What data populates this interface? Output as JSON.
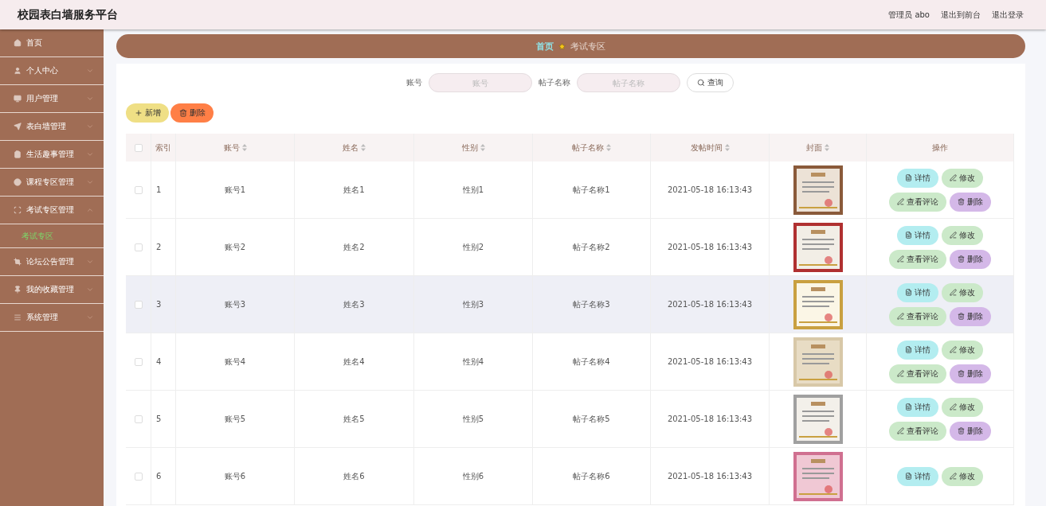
{
  "header": {
    "title": "校园表白墙服务平台",
    "links": [
      "管理员 abo",
      "退出到前台",
      "退出登录"
    ]
  },
  "sidebar": {
    "items": [
      {
        "label": "首页",
        "expandable": false
      },
      {
        "label": "个人中心",
        "expandable": true,
        "expanded": false
      },
      {
        "label": "用户管理",
        "expandable": true,
        "expanded": false
      },
      {
        "label": "表白墙管理",
        "expandable": true,
        "expanded": false
      },
      {
        "label": "生活趣事管理",
        "expandable": true,
        "expanded": false
      },
      {
        "label": "课程专区管理",
        "expandable": true,
        "expanded": false
      },
      {
        "label": "考试专区管理",
        "expandable": true,
        "expanded": true,
        "children": [
          {
            "label": "考试专区",
            "selected": true
          }
        ]
      },
      {
        "label": "论坛公告管理",
        "expandable": true,
        "expanded": false
      },
      {
        "label": "我的收藏管理",
        "expandable": true,
        "expanded": false
      },
      {
        "label": "系统管理",
        "expandable": true,
        "expanded": false
      }
    ]
  },
  "breadcrumb": [
    "首页",
    "考试专区"
  ],
  "search": {
    "fields": [
      {
        "label": "账号",
        "placeholder": "账号"
      },
      {
        "label": "帖子名称",
        "placeholder": "帖子名称"
      }
    ],
    "button": "查询"
  },
  "actions": [
    {
      "label": "新增",
      "kind": "add"
    },
    {
      "label": "删除",
      "kind": "delete"
    }
  ],
  "table": {
    "all_checked": false,
    "columns": [
      {
        "label": "索引",
        "sortable": false
      },
      {
        "label": "账号",
        "sortable": true
      },
      {
        "label": "姓名",
        "sortable": true
      },
      {
        "label": "性别",
        "sortable": true
      },
      {
        "label": "帖子名称",
        "sortable": true
      },
      {
        "label": "发帖时间",
        "sortable": true
      },
      {
        "label": "封面",
        "sortable": true
      },
      {
        "label": "操作",
        "sortable": false
      }
    ],
    "rows": [
      {
        "index": "1",
        "account": "账号1",
        "name": "姓名1",
        "gender": "性别1",
        "post": "帖子名称1",
        "time": "2021-05-18 16:13:43",
        "cover": {
          "kind": "picture"
        },
        "checked": false,
        "highlighted": false,
        "buttons": [
          {
            "label": "详情",
            "kind": "detail"
          },
          {
            "label": "修改",
            "kind": "edit"
          },
          {
            "label": "查看评论",
            "kind": "comment"
          },
          {
            "label": "删除",
            "kind": "delete"
          }
        ]
      },
      {
        "index": "2",
        "account": "账号2",
        "name": "姓名2",
        "gender": "性别2",
        "post": "帖子名称2",
        "time": "2021-05-18 16:13:43",
        "cover": {
          "kind": "picture"
        },
        "checked": false,
        "highlighted": false,
        "buttons": [
          {
            "label": "详情",
            "kind": "detail"
          },
          {
            "label": "修改",
            "kind": "edit"
          },
          {
            "label": "查看评论",
            "kind": "comment"
          },
          {
            "label": "删除",
            "kind": "delete"
          }
        ]
      },
      {
        "index": "3",
        "account": "账号3",
        "name": "姓名3",
        "gender": "性别3",
        "post": "帖子名称3",
        "time": "2021-05-18 16:13:43",
        "cover": {
          "kind": "picture"
        },
        "checked": false,
        "highlighted": true,
        "buttons": [
          {
            "label": "详情",
            "kind": "detail"
          },
          {
            "label": "修改",
            "kind": "edit"
          },
          {
            "label": "查看评论",
            "kind": "comment"
          },
          {
            "label": "删除",
            "kind": "delete"
          }
        ]
      },
      {
        "index": "4",
        "account": "账号4",
        "name": "姓名4",
        "gender": "性别4",
        "post": "帖子名称4",
        "time": "2021-05-18 16:13:43",
        "cover": {
          "kind": "picture"
        },
        "checked": false,
        "highlighted": false,
        "buttons": [
          {
            "label": "详情",
            "kind": "detail"
          },
          {
            "label": "修改",
            "kind": "edit"
          },
          {
            "label": "查看评论",
            "kind": "comment"
          },
          {
            "label": "删除",
            "kind": "delete"
          }
        ]
      },
      {
        "index": "5",
        "account": "账号5",
        "name": "姓名5",
        "gender": "性别5",
        "post": "帖子名称5",
        "time": "2021-05-18 16:13:43",
        "cover": {
          "kind": "picture"
        },
        "checked": false,
        "highlighted": false,
        "buttons": [
          {
            "label": "详情",
            "kind": "detail"
          },
          {
            "label": "修改",
            "kind": "edit"
          },
          {
            "label": "查看评论",
            "kind": "comment"
          },
          {
            "label": "删除",
            "kind": "delete"
          }
        ]
      },
      {
        "index": "6",
        "account": "账号6",
        "name": "姓名6",
        "gender": "性别6",
        "post": "帖子名称6",
        "time": "2021-05-18 16:13:43",
        "cover": {
          "kind": "picture"
        },
        "checked": false,
        "highlighted": false,
        "buttons": [
          {
            "label": "详情",
            "kind": "detail"
          },
          {
            "label": "修改",
            "kind": "edit"
          }
        ]
      }
    ]
  }
}
